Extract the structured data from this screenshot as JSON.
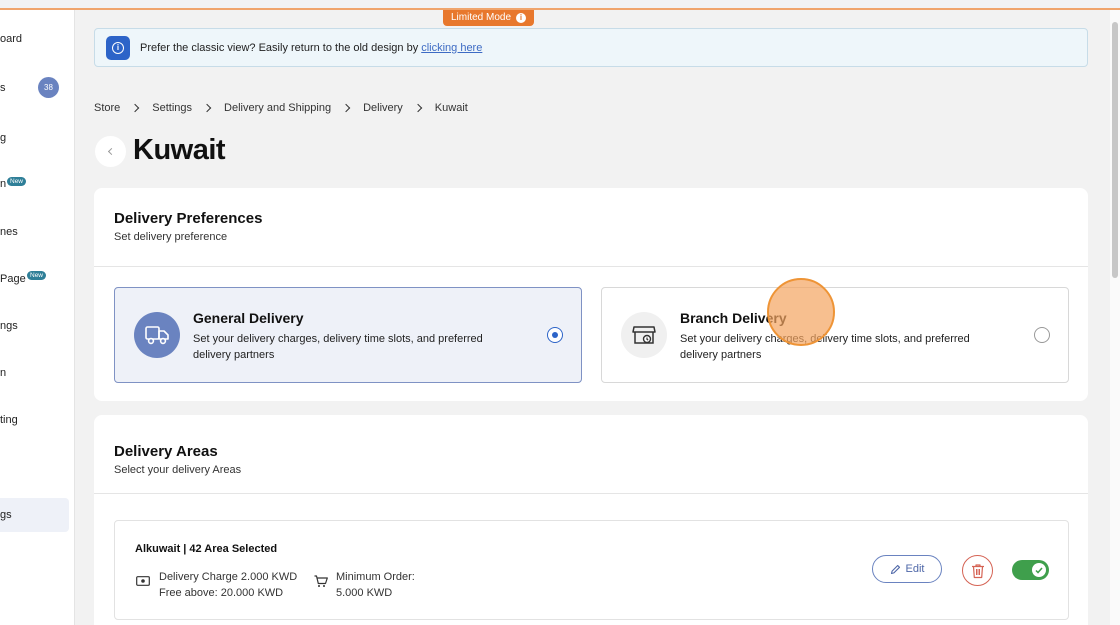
{
  "limited_mode": "Limited Mode",
  "sidebar": {
    "items": [
      {
        "label": "oard"
      },
      {
        "label": "s",
        "count": "38"
      },
      {
        "label": "g"
      },
      {
        "label": "n",
        "badge": "New"
      },
      {
        "label": "nes"
      },
      {
        "label": "Page",
        "badge": "New"
      },
      {
        "label": "ngs"
      },
      {
        "label": "n"
      },
      {
        "label": "ting"
      },
      {
        "label": "gs"
      }
    ]
  },
  "banner": {
    "text": "Prefer the classic view? Easily return to the old design by",
    "link": "clicking here"
  },
  "breadcrumb": [
    "Store",
    "Settings",
    "Delivery and Shipping",
    "Delivery",
    "Kuwait"
  ],
  "page_title": "Kuwait",
  "delivery_preferences": {
    "title": "Delivery Preferences",
    "subtitle": "Set delivery preference",
    "options": [
      {
        "title": "General Delivery",
        "desc": "Set your delivery charges, delivery time slots, and preferred delivery partners",
        "selected": true
      },
      {
        "title": "Branch Delivery",
        "desc": "Set your delivery charges, delivery time slots, and preferred delivery partners",
        "selected": false
      }
    ]
  },
  "delivery_areas": {
    "title": "Delivery Areas",
    "subtitle": "Select your delivery Areas",
    "items": [
      {
        "name": "Alkuwait | 42 Area Selected",
        "charge_line1": "Delivery Charge 2.000 KWD",
        "charge_line2": "Free above: 20.000 KWD",
        "min_line1": "Minimum Order:",
        "min_line2": "5.000 KWD",
        "edit_label": "Edit",
        "enabled": true
      }
    ]
  },
  "colors": {
    "accent": "#6a83c0",
    "primary_blue": "#2d64c8",
    "limited_orange": "#e8782d",
    "toggle_green": "#3f9f4c",
    "delete_red": "#d56354"
  }
}
